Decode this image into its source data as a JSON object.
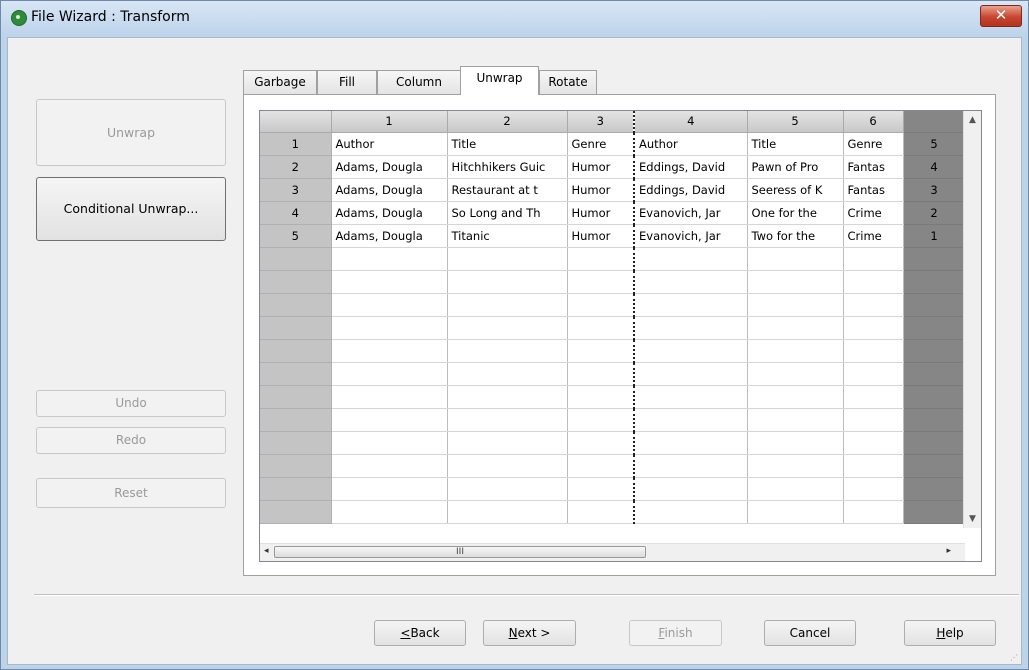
{
  "window": {
    "title": "File Wizard : Transform",
    "close_glyph": "✕"
  },
  "left_buttons": {
    "unwrap": "Unwrap",
    "conditional_unwrap": "Conditional Unwrap...",
    "undo": "Undo",
    "redo": "Redo",
    "reset": "Reset"
  },
  "tabs": [
    "Garbage",
    "Fill",
    "Column",
    "Unwrap",
    "Rotate"
  ],
  "active_tab": "Unwrap",
  "grid": {
    "columns": [
      "1",
      "2",
      "3",
      "4",
      "5",
      "6"
    ],
    "rows": [
      {
        "num": "1",
        "cells": [
          "Author",
          "Title",
          "Genre",
          "Author",
          "Title",
          "Genre"
        ],
        "right": "5"
      },
      {
        "num": "2",
        "cells": [
          "Adams, Dougla",
          "Hitchhikers Guic",
          "Humor",
          "Eddings, David",
          "Pawn of Pro",
          "Fantas"
        ],
        "right": "4"
      },
      {
        "num": "3",
        "cells": [
          "Adams, Dougla",
          "Restaurant at t",
          "Humor",
          "Eddings, David",
          "Seeress of K",
          "Fantas"
        ],
        "right": "3"
      },
      {
        "num": "4",
        "cells": [
          "Adams, Dougla",
          "So Long and Th",
          "Humor",
          "Evanovich, Jar",
          "One for the",
          "Crime"
        ],
        "right": "2"
      },
      {
        "num": "5",
        "cells": [
          "Adams, Dougla",
          "Titanic",
          "Humor",
          "Evanovich, Jar",
          "Two for the",
          "Crime"
        ],
        "right": "1"
      }
    ],
    "empty_rows": 12,
    "scroll_up_glyph": "▲",
    "scroll_down_glyph": "▼",
    "scroll_left_glyph": "◂",
    "scroll_right_glyph": "▸",
    "scroll_thumb_glyph": "III"
  },
  "footer": {
    "back_rest": "Back",
    "back_accel": "<",
    "next_accel": "N",
    "next_rest": "ext >",
    "finish_accel": "F",
    "finish_rest": "inish",
    "cancel": "Cancel",
    "help_accel": "H",
    "help_rest": "elp"
  }
}
